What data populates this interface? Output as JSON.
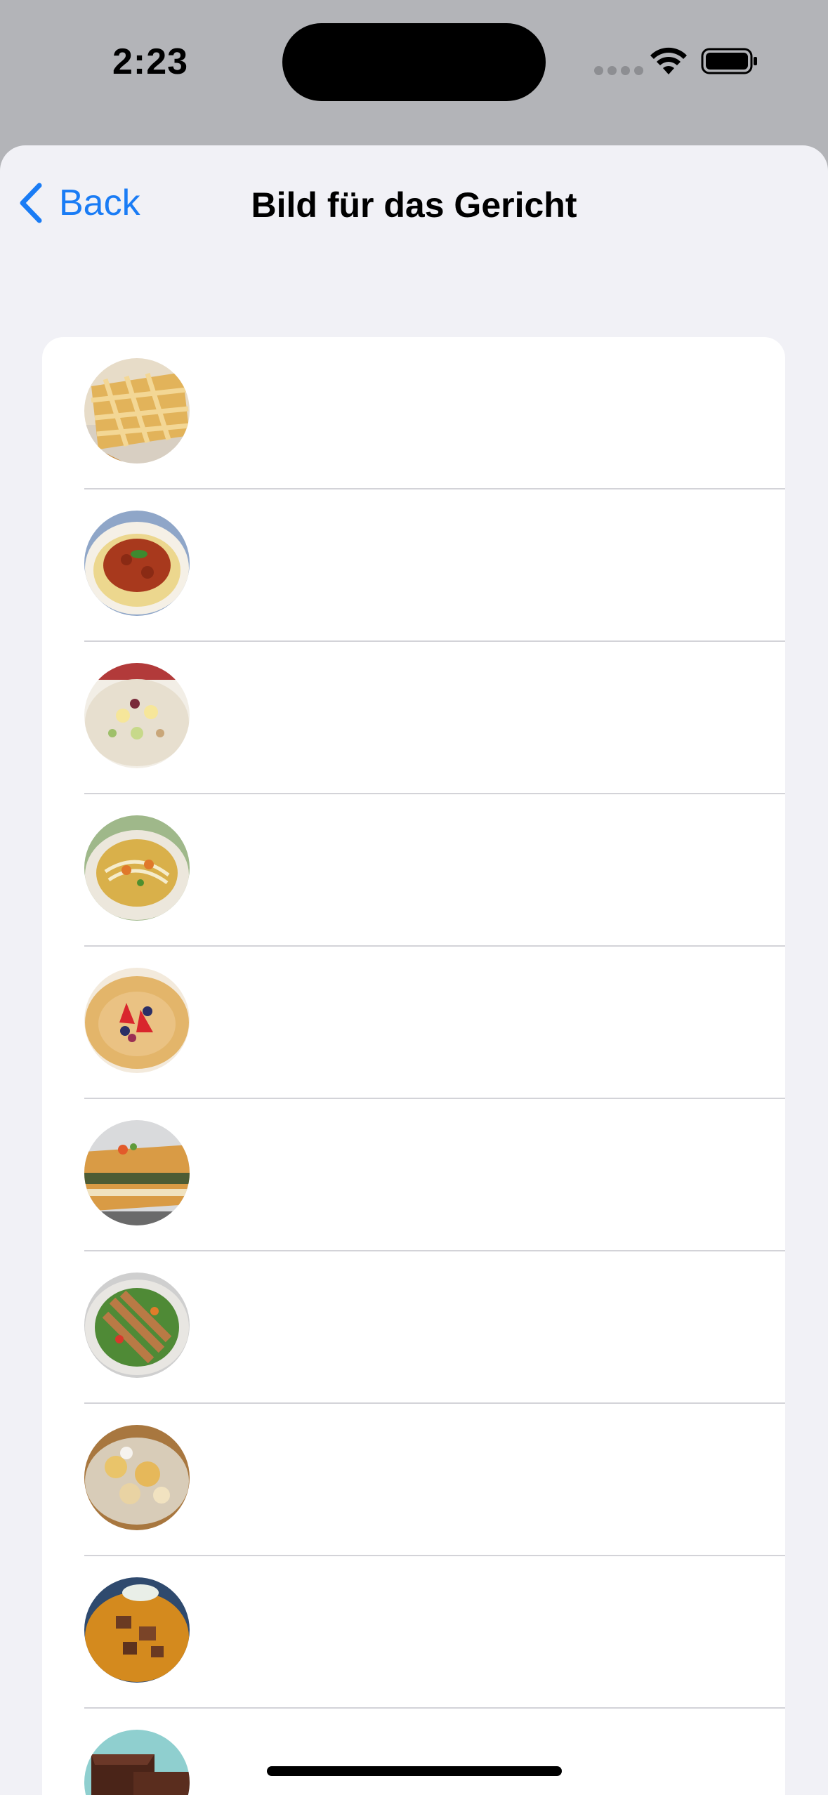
{
  "status_bar": {
    "time": "2:23",
    "wifi_icon": "wifi-icon",
    "battery_icon": "battery-icon"
  },
  "nav": {
    "back_label": "Back",
    "back_icon": "chevron-left-icon",
    "title": "Bild für das Gericht"
  },
  "colors": {
    "accent": "#1a7cf5",
    "sheet_background": "#f1f1f6",
    "card_background": "#ffffff",
    "separator": "#d3d3d8"
  },
  "dish_images": [
    {
      "id": "lattice-pie-image"
    },
    {
      "id": "spaghetti-bolognese-image"
    },
    {
      "id": "egg-salad-image"
    },
    {
      "id": "noodle-soup-image"
    },
    {
      "id": "berry-crepes-image"
    },
    {
      "id": "lasagna-image"
    },
    {
      "id": "chicken-salad-image"
    },
    {
      "id": "kaiserschmarrn-image"
    },
    {
      "id": "goulash-image"
    },
    {
      "id": "chocolate-brownie-image"
    }
  ]
}
